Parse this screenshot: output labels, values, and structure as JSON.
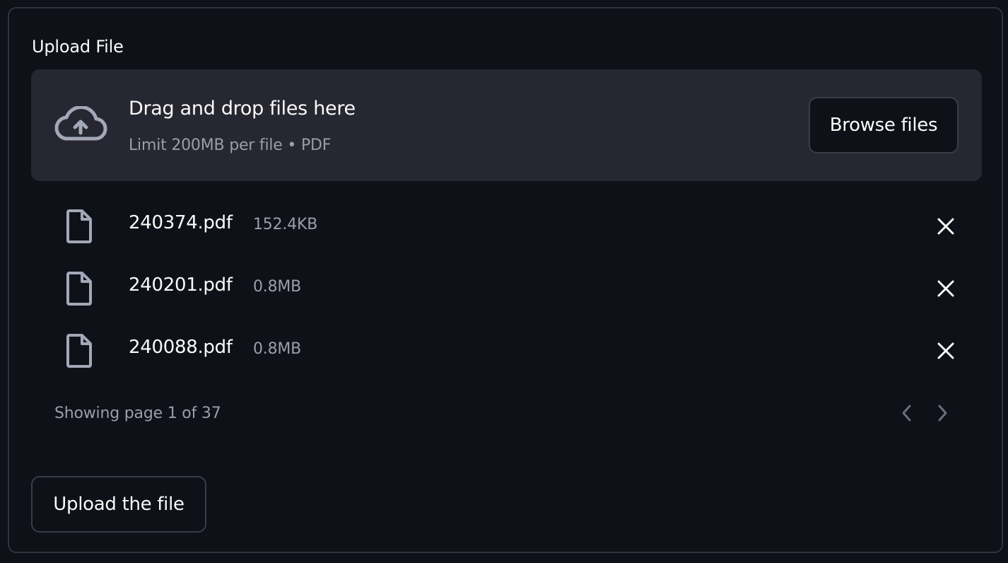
{
  "uploader": {
    "label": "Upload File",
    "dropzone": {
      "title": "Drag and drop files here",
      "subtitle": "Limit 200MB per file • PDF",
      "icon": "cloud-upload-icon",
      "browse_label": "Browse files"
    },
    "files": [
      {
        "name": "240374.pdf",
        "size": "152.4KB"
      },
      {
        "name": "240201.pdf",
        "size": "0.8MB"
      },
      {
        "name": "240088.pdf",
        "size": "0.8MB"
      }
    ],
    "pagination": {
      "text": "Showing page 1 of 37",
      "current_page": 1,
      "total_pages": 37
    }
  },
  "actions": {
    "upload_label": "Upload the file"
  },
  "colors": {
    "background": "#0e1117",
    "dropzone": "#262730",
    "border": "#31333f",
    "text": "#fafafa",
    "muted_text": "#9a9ea8",
    "icon": "#a3a8b8"
  }
}
